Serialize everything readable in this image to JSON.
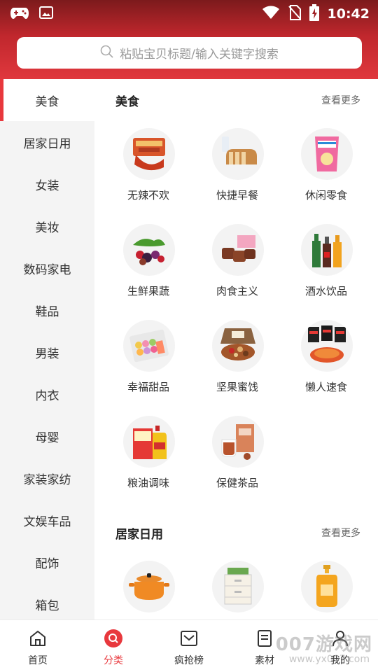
{
  "status_bar": {
    "time": "10:42"
  },
  "search": {
    "placeholder": "粘贴宝贝标题/输入关键字搜索"
  },
  "sidebar": {
    "items": [
      {
        "label": "美食",
        "active": true
      },
      {
        "label": "居家日用"
      },
      {
        "label": "女装"
      },
      {
        "label": "美妆"
      },
      {
        "label": "数码家电"
      },
      {
        "label": "鞋品"
      },
      {
        "label": "男装"
      },
      {
        "label": "内衣"
      },
      {
        "label": "母婴"
      },
      {
        "label": "家装家纺"
      },
      {
        "label": "文娱车品"
      },
      {
        "label": "配饰"
      },
      {
        "label": "箱包"
      }
    ]
  },
  "sections": [
    {
      "title": "美食",
      "more": "查看更多",
      "items": [
        {
          "label": "无辣不欢",
          "icon": "spicy-snacks"
        },
        {
          "label": "快捷早餐",
          "icon": "bread"
        },
        {
          "label": "休闲零食",
          "icon": "chips-bag"
        },
        {
          "label": "生鲜果蔬",
          "icon": "fruits"
        },
        {
          "label": "肉食主义",
          "icon": "braised-meat"
        },
        {
          "label": "酒水饮品",
          "icon": "bottles"
        },
        {
          "label": "幸福甜品",
          "icon": "macarons"
        },
        {
          "label": "坚果蜜饯",
          "icon": "nuts-box"
        },
        {
          "label": "懒人速食",
          "icon": "instant-noodles"
        },
        {
          "label": "粮油调味",
          "icon": "rice-oil"
        },
        {
          "label": "保健茶品",
          "icon": "tea"
        }
      ]
    },
    {
      "title": "居家日用",
      "more": "查看更多",
      "items": [
        {
          "label": "",
          "icon": "cast-iron-pot"
        },
        {
          "label": "",
          "icon": "storage-drawers"
        },
        {
          "label": "",
          "icon": "shampoo-bottle"
        }
      ]
    }
  ],
  "bottom_nav": [
    {
      "label": "首页",
      "icon": "home-icon"
    },
    {
      "label": "分类",
      "icon": "search-circle-icon",
      "active": true
    },
    {
      "label": "疯抢榜",
      "icon": "ranking-icon"
    },
    {
      "label": "素材",
      "icon": "document-icon"
    },
    {
      "label": "我的",
      "icon": "user-icon"
    }
  ],
  "watermark": {
    "text": "007游戏网",
    "sub": "www.yx007.com"
  },
  "colors": {
    "accent": "#e8383d",
    "header_dark": "#7c1a1c",
    "sidebar_bg": "#f4f4f4"
  }
}
